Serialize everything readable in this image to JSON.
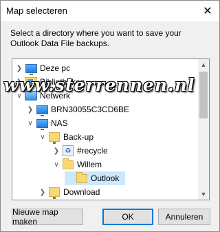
{
  "window": {
    "title": "Map selecteren",
    "close_glyph": "✕"
  },
  "description": "Select a directory where you want to save your Outlook Data File backups.",
  "tree": {
    "items": [
      {
        "label": "Deze pc",
        "icon": "monitor-icon",
        "expander": "collapsed"
      },
      {
        "label": "Bibliotheken",
        "icon": "libraries-icon",
        "expander": "collapsed"
      },
      {
        "label": "Netwerk",
        "icon": "network-icon",
        "expander": "expanded"
      },
      {
        "label": "BRN30055C3CD6BE",
        "icon": "computer-icon",
        "expander": "collapsed"
      },
      {
        "label": "NAS",
        "icon": "computer-icon",
        "expander": "expanded"
      },
      {
        "label": "Back-up",
        "icon": "network-share-icon",
        "expander": "expanded"
      },
      {
        "label": "#recycle",
        "icon": "recycle-folder-icon",
        "expander": "collapsed"
      },
      {
        "label": "Willem",
        "icon": "folder-icon",
        "expander": "expanded"
      },
      {
        "label": "Outlook",
        "icon": "folder-icon",
        "expander": "none",
        "selected": true
      },
      {
        "label": "Download",
        "icon": "network-share-icon",
        "expander": "collapsed"
      }
    ]
  },
  "buttons": {
    "new_folder": "Nieuwe map maken",
    "ok": "OK",
    "cancel": "Annuleren"
  },
  "watermark": "www.sterrennen.nl",
  "colors": {
    "selection": "#cce8ff",
    "default_button_border": "#0078d7",
    "folder": "#f8d775"
  }
}
